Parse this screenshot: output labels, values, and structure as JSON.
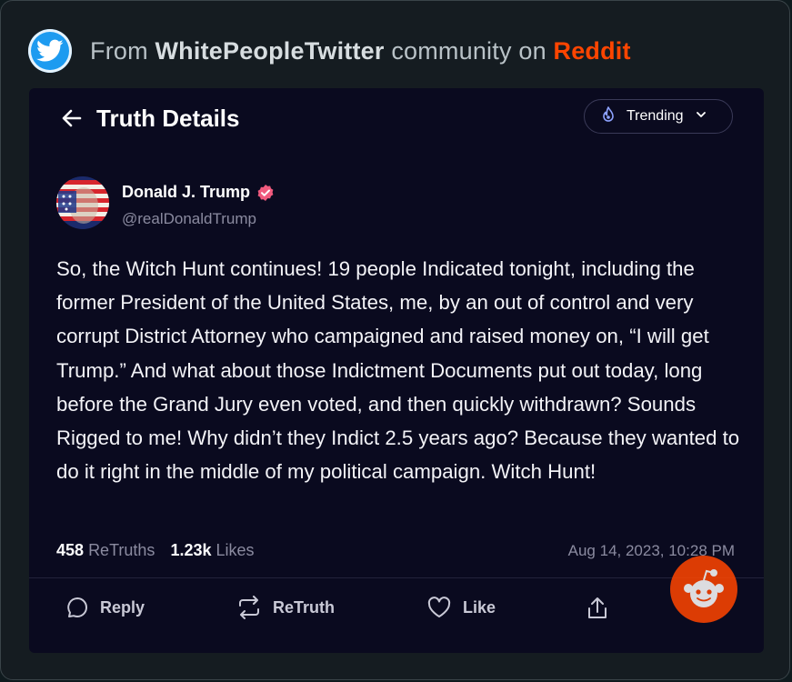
{
  "source": {
    "prefix": "From",
    "community": "WhitePeopleTwitter",
    "middle": "community on",
    "platform": "Reddit"
  },
  "header": {
    "title": "Truth Details",
    "filter_label": "Trending"
  },
  "post": {
    "author_name": "Donald J. Trump",
    "handle": "@realDonaldTrump",
    "text": "So, the Witch Hunt continues! 19 people Indicated tonight, including the former President of the United States, me, by an out of control and very corrupt District Attorney who campaigned and raised money on, “I will get Trump.” And what about those Indictment Documents put out today, long before the Grand Jury even voted, and then quickly withdrawn? Sounds Rigged to me! Why didn’t they Indict 2.5 years ago? Because they wanted to do it right in the middle of my political campaign. Witch Hunt!",
    "retruths_count": "458",
    "retruths_label": "ReTruths",
    "likes_count": "1.23k",
    "likes_label": "Likes",
    "timestamp": "Aug 14, 2023, 10:28 PM"
  },
  "actions": {
    "reply": "Reply",
    "retruth": "ReTruth",
    "like": "Like"
  },
  "colors": {
    "reddit": "#ff4500",
    "twitter": "#1d9bf0",
    "card_bg": "#0a0a1f",
    "verified": "#f05a7e"
  },
  "icons": [
    "twitter-bird-icon",
    "back-arrow-icon",
    "trending-flame-icon",
    "chevron-down-icon",
    "verified-badge-icon",
    "reply-icon",
    "retruth-icon",
    "like-heart-icon",
    "share-icon",
    "reddit-snoo-icon"
  ]
}
